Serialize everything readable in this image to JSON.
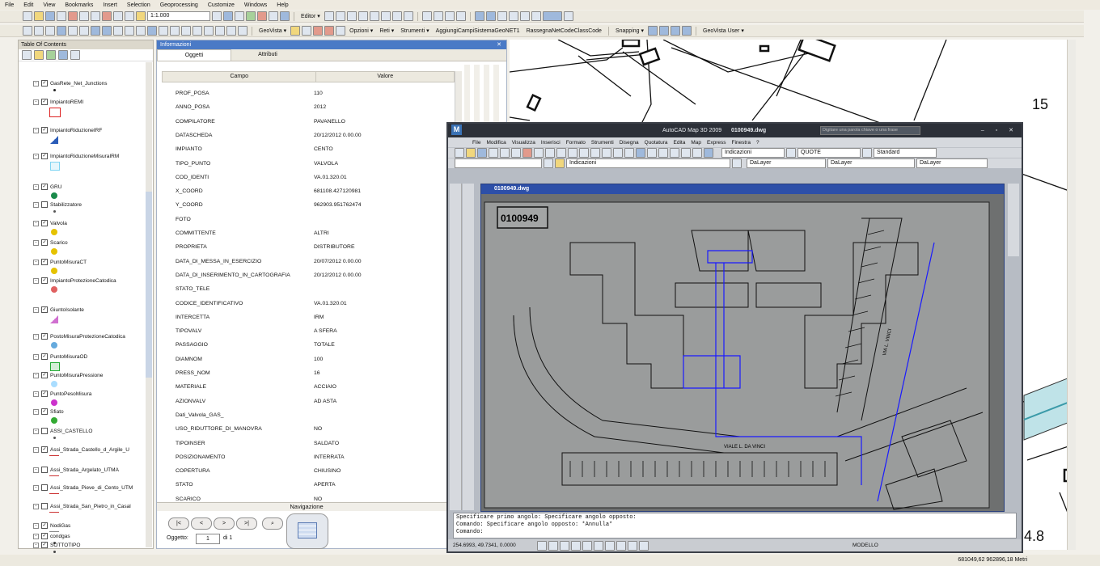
{
  "menubar": [
    "File",
    "Edit",
    "View",
    "Bookmarks",
    "Insert",
    "Selection",
    "Geoprocessing",
    "Customize",
    "Windows",
    "Help"
  ],
  "toolbar1": {
    "scale": "1:1.000",
    "editor": "Editor ▾"
  },
  "toolbar2": {
    "geovista": "GeoVista ▾",
    "opzioni": "Opzioni ▾",
    "reti": "Reti ▾",
    "strumenti": "Strumenti ▾",
    "agg": "AggiungiCampiSistemaGeoNET1",
    "rassegna": "RassegnaNetCodeClassCode",
    "snapping": "Snapping ▾",
    "geovista_user": "GeoVista User ▾"
  },
  "toc": {
    "title": "Table Of Contents",
    "items": [
      "GasRete_Net_Junctions",
      "ImpiantoREMI",
      "ImpiantoRiduzioneIRF",
      "ImpiantoRiduzioneMisuraIRM",
      "GRU",
      "Stabilizzatore",
      "Valvola",
      "Scarico",
      "PuntoMisuraCT",
      "ImpiantoProtezioneCatodica",
      "GiuntoIsolante",
      "PostoMisuraProtezioneCatodica",
      "PuntoMisuraOD",
      "PuntoMisuraPressione",
      "PuntoPesoMisura",
      "Sfiato",
      "ASSI_CASTELLO",
      "Assi_Strada_Castello_d_Argile_U",
      "Assi_Strada_Argelato_UTMA",
      "Assi_Strada_Pieve_di_Cento_UTM",
      "Assi_Strada_San_Pietro_in_Casal",
      "NodiGas",
      "condgas",
      "SOTTOTIPO"
    ]
  },
  "info": {
    "title": "Informazioni",
    "tabs": [
      "Oggetti",
      "Attributi"
    ],
    "col_campo": "Campo",
    "col_valore": "Valore",
    "rows": [
      [
        "PROF_POSA",
        "110"
      ],
      [
        "ANNO_POSA",
        "2012"
      ],
      [
        "COMPILATORE",
        "PAVANELLO"
      ],
      [
        "DATASCHEDA",
        "20/12/2012 0.00.00"
      ],
      [
        "IMPIANTO",
        "CENTO"
      ],
      [
        "TIPO_PUNTO",
        "VALVOLA"
      ],
      [
        "COD_IDENTI",
        "VA.01.320.01"
      ],
      [
        "X_COORD",
        "681108.427120981"
      ],
      [
        "Y_COORD",
        "962903.951762474"
      ],
      [
        "FOTO",
        ""
      ],
      [
        "COMMITTENTE",
        "ALTRI"
      ],
      [
        "PROPRIETA",
        "DISTRIBUTORE"
      ],
      [
        "DATA_DI_MESSA_IN_ESERCIZIO",
        "20/07/2012 0.00.00"
      ],
      [
        "DATA_DI_INSERIMENTO_IN_CARTOGRAFIA",
        "20/12/2012 0.00.00"
      ],
      [
        "STATO_TELE",
        ""
      ],
      [
        "CODICE_IDENTIFICATIVO",
        "VA.01.320.01"
      ],
      [
        "INTERCETTA",
        "IRM"
      ],
      [
        "TIPOVALV",
        "A SFERA"
      ],
      [
        "PASSAGGIO",
        "TOTALE"
      ],
      [
        "DIAMNOM",
        "100"
      ],
      [
        "PRESS_NOM",
        "16"
      ],
      [
        "MATERIALE",
        "ACCIAIO"
      ],
      [
        "AZIONVALV",
        "AD ASTA"
      ],
      [
        "Dati_Valvola_GAS_",
        ""
      ],
      [
        "USO_RIDUTTORE_DI_MANOVRA",
        "NO"
      ],
      [
        "TIPOINSER",
        "SALDATO"
      ],
      [
        "POSIZIONAMENTO",
        "INTERRATA"
      ],
      [
        "COPERTURA",
        "CHIUSINO"
      ],
      [
        "STATO",
        "APERTA"
      ],
      [
        "SCARICO",
        "NO"
      ]
    ],
    "nav_label": "Navigazione",
    "nav_buttons": [
      "|<",
      "<",
      ">",
      ">|"
    ],
    "oggetto_label": "Oggetto:",
    "oggetto_value": "1",
    "oggetto_of": "di 1"
  },
  "map": {
    "label_15": "15",
    "label_48": "4.8"
  },
  "acad": {
    "title": "AutoCAD Map 3D 2009",
    "file": "0100949.dwg",
    "search_placeholder": "Digitare una parola chiave o una frase",
    "menu": [
      "File",
      "Modifica",
      "Visualizza",
      "Inserisci",
      "Formato",
      "Strumenti",
      "Disegna",
      "Quotatura",
      "Edita",
      "Map",
      "Express",
      "Finestra",
      "?"
    ],
    "layer": "Indicazioni",
    "dim": "QUOTE",
    "style": "Standard",
    "bylayer": "DaLayer",
    "drawing_id": "0100949",
    "street": "VIALE L. DA VINCI",
    "street2": "VIA L. VINCI",
    "cmd_lines": [
      "Specificare primo angolo: Specificare angolo opposto:",
      "Comando: Specificare angolo opposto: *Annulla*",
      "Comando:"
    ],
    "coords": "254.6993, 49.7341, 0.0000",
    "model": "MODELLO"
  },
  "status": {
    "coords": "681049,62  962896,18 Metri"
  }
}
